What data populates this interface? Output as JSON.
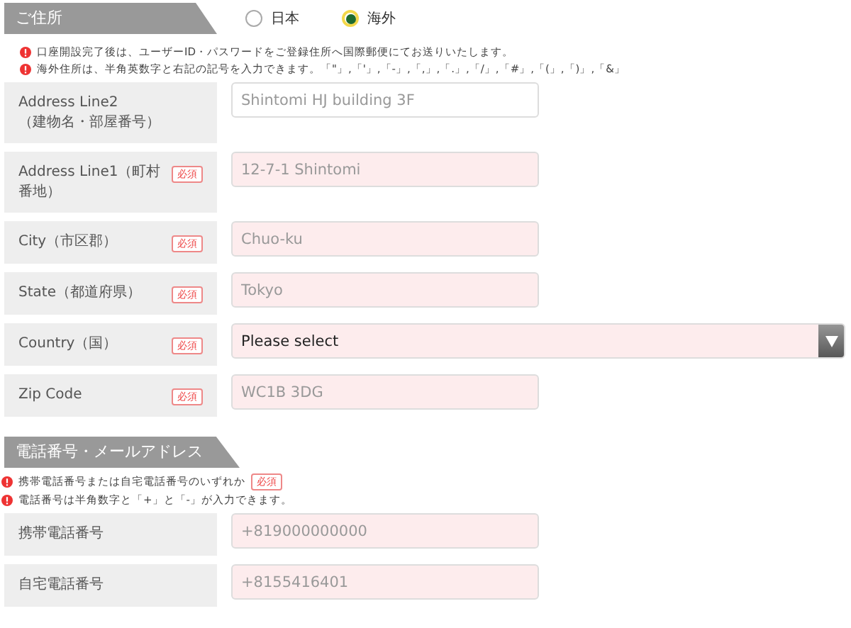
{
  "address_section": {
    "title": "ご住所",
    "options": [
      {
        "label": "日本",
        "selected": false
      },
      {
        "label": "海外",
        "selected": true
      }
    ],
    "notes": [
      "口座開設完了後は、ユーザーID・パスワードをご登録住所へ国際郵便にてお送りいたします。",
      "海外住所は、半角英数字と右記の記号を入力できます。「\"」,「'」,「-」,「,」,「.」,「/」,「#」,「(」,「)」,「&」"
    ],
    "fields": [
      {
        "label": "Address Line2\n（建物名・部屋番号）",
        "kind": "text",
        "placeholder": "Shintomi HJ building 3F",
        "invalid": false
      },
      {
        "label": "Address Line1（町村番地）",
        "kind": "text",
        "required": "必須",
        "placeholder": "12-7-1 Shintomi",
        "invalid": true
      },
      {
        "label": "City（市区郡）",
        "kind": "text",
        "required": "必須",
        "placeholder": "Chuo-ku",
        "invalid": true
      },
      {
        "label": "State（都道府県）",
        "kind": "text",
        "required": "必須",
        "placeholder": "Tokyo",
        "invalid": true
      },
      {
        "label": "Country（国）",
        "kind": "select",
        "required": "必須",
        "value": "Please select",
        "invalid": true
      },
      {
        "label": "Zip Code",
        "kind": "text",
        "required": "必須",
        "placeholder": "WC1B 3DG",
        "invalid": true
      }
    ]
  },
  "phone_section": {
    "title": "電話番号・メールアドレス",
    "notes": [
      {
        "text": "携帯電話番号または自宅電話番号のいずれか",
        "required": "必須"
      },
      {
        "text": "電話番号は半角数字と「+」と「-」が入力できます。"
      }
    ],
    "fields": [
      {
        "label": "携帯電話番号",
        "kind": "text",
        "placeholder": "+819000000000",
        "invalid": true
      },
      {
        "label": "自宅電話番号",
        "kind": "text",
        "placeholder": "+8155416401",
        "invalid": true
      }
    ]
  }
}
